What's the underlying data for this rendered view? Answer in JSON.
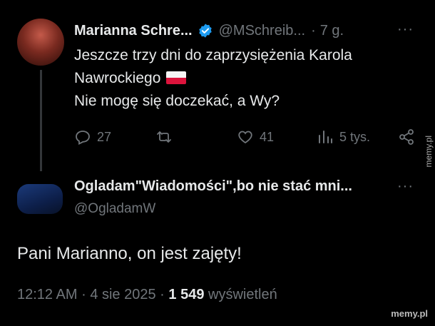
{
  "tweet": {
    "author_name": "Marianna Schre...",
    "author_handle": "@MSchreib...",
    "separator": "·",
    "time": "7 g.",
    "more": "···",
    "text_line1": "Jeszcze trzy dni do zaprzysiężenia Karola",
    "text_line2": "Nawrockiego",
    "text_line3": "Nie mogę się doczekać, a Wy?",
    "replies": "27",
    "retweets": "",
    "likes": "41",
    "views": "5 tys."
  },
  "reply": {
    "author_name": "Ogladam\"Wiadomości\",bo nie stać mni...",
    "author_handle": "@OgladamW",
    "more": "···",
    "text": "Pani Marianno, on jest zajęty!",
    "time": "12:12 AM",
    "date": "4 sie 2025",
    "views_count": "1 549",
    "views_label": "wyświetleń",
    "sep": "·"
  },
  "watermarks": {
    "side": "memy.pl",
    "bottom": "memy.pl"
  },
  "colors": {
    "background": "#000000",
    "primary_text": "#e7e9ea",
    "secondary_text": "#71767b",
    "verified": "#1d9bf0"
  },
  "icons": [
    "reply-icon",
    "retweet-icon",
    "like-icon",
    "views-icon",
    "share-icon",
    "verified-icon",
    "more-icon",
    "poland-flag-icon"
  ]
}
